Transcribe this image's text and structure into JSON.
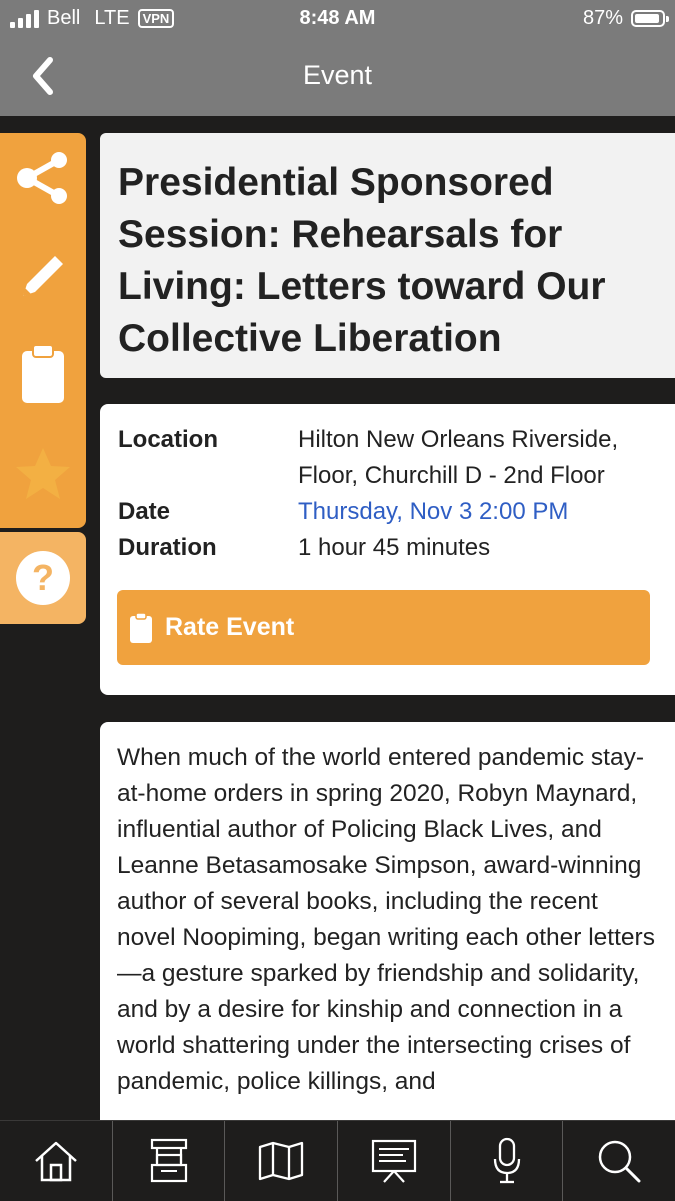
{
  "status_bar": {
    "carrier": "Bell",
    "network": "LTE",
    "vpn": "VPN",
    "time": "8:48 AM",
    "battery": "87%"
  },
  "nav": {
    "title": "Event",
    "back_icon": "chevron-left-icon"
  },
  "sidebar": {
    "items": [
      {
        "icon": "share-icon"
      },
      {
        "icon": "pencil-icon"
      },
      {
        "icon": "clipboard-icon"
      },
      {
        "icon": "star-icon"
      }
    ],
    "help_icon": "question-icon"
  },
  "event": {
    "title": "Presidential Sponsored Session: Rehearsals for Living: Letters toward Our Collective Liberation",
    "location_label": "Location",
    "location_value": "Hilton New Orleans Riverside, Floor, Churchill D - 2nd Floor",
    "date_label": "Date",
    "date_value": "Thursday, Nov 3 2:00 PM",
    "duration_label": "Duration",
    "duration_value": "1 hour 45 minutes",
    "rate_button": "Rate Event",
    "description": "When much of the world entered pandemic stay-at-home orders in spring 2020, Robyn Maynard, influential author of Policing Black Lives, and Leanne Betasamosake Simpson, award-winning author of several books, including the recent novel Noopiming, began writing each other letters—a gesture sparked by friendship and solidarity, and by a desire for kinship and connection in a world shattering under the intersecting crises of pandemic, police killings, and"
  },
  "tabbar": {
    "items": [
      {
        "icon": "home-icon"
      },
      {
        "icon": "exhibit-booth-icon"
      },
      {
        "icon": "map-icon"
      },
      {
        "icon": "presentation-icon"
      },
      {
        "icon": "microphone-icon"
      },
      {
        "icon": "search-icon"
      }
    ]
  },
  "colors": {
    "accent": "#f0a23e",
    "header": "#7b7b7b",
    "link": "#2f5ec4",
    "background": "#1e1d1c"
  }
}
